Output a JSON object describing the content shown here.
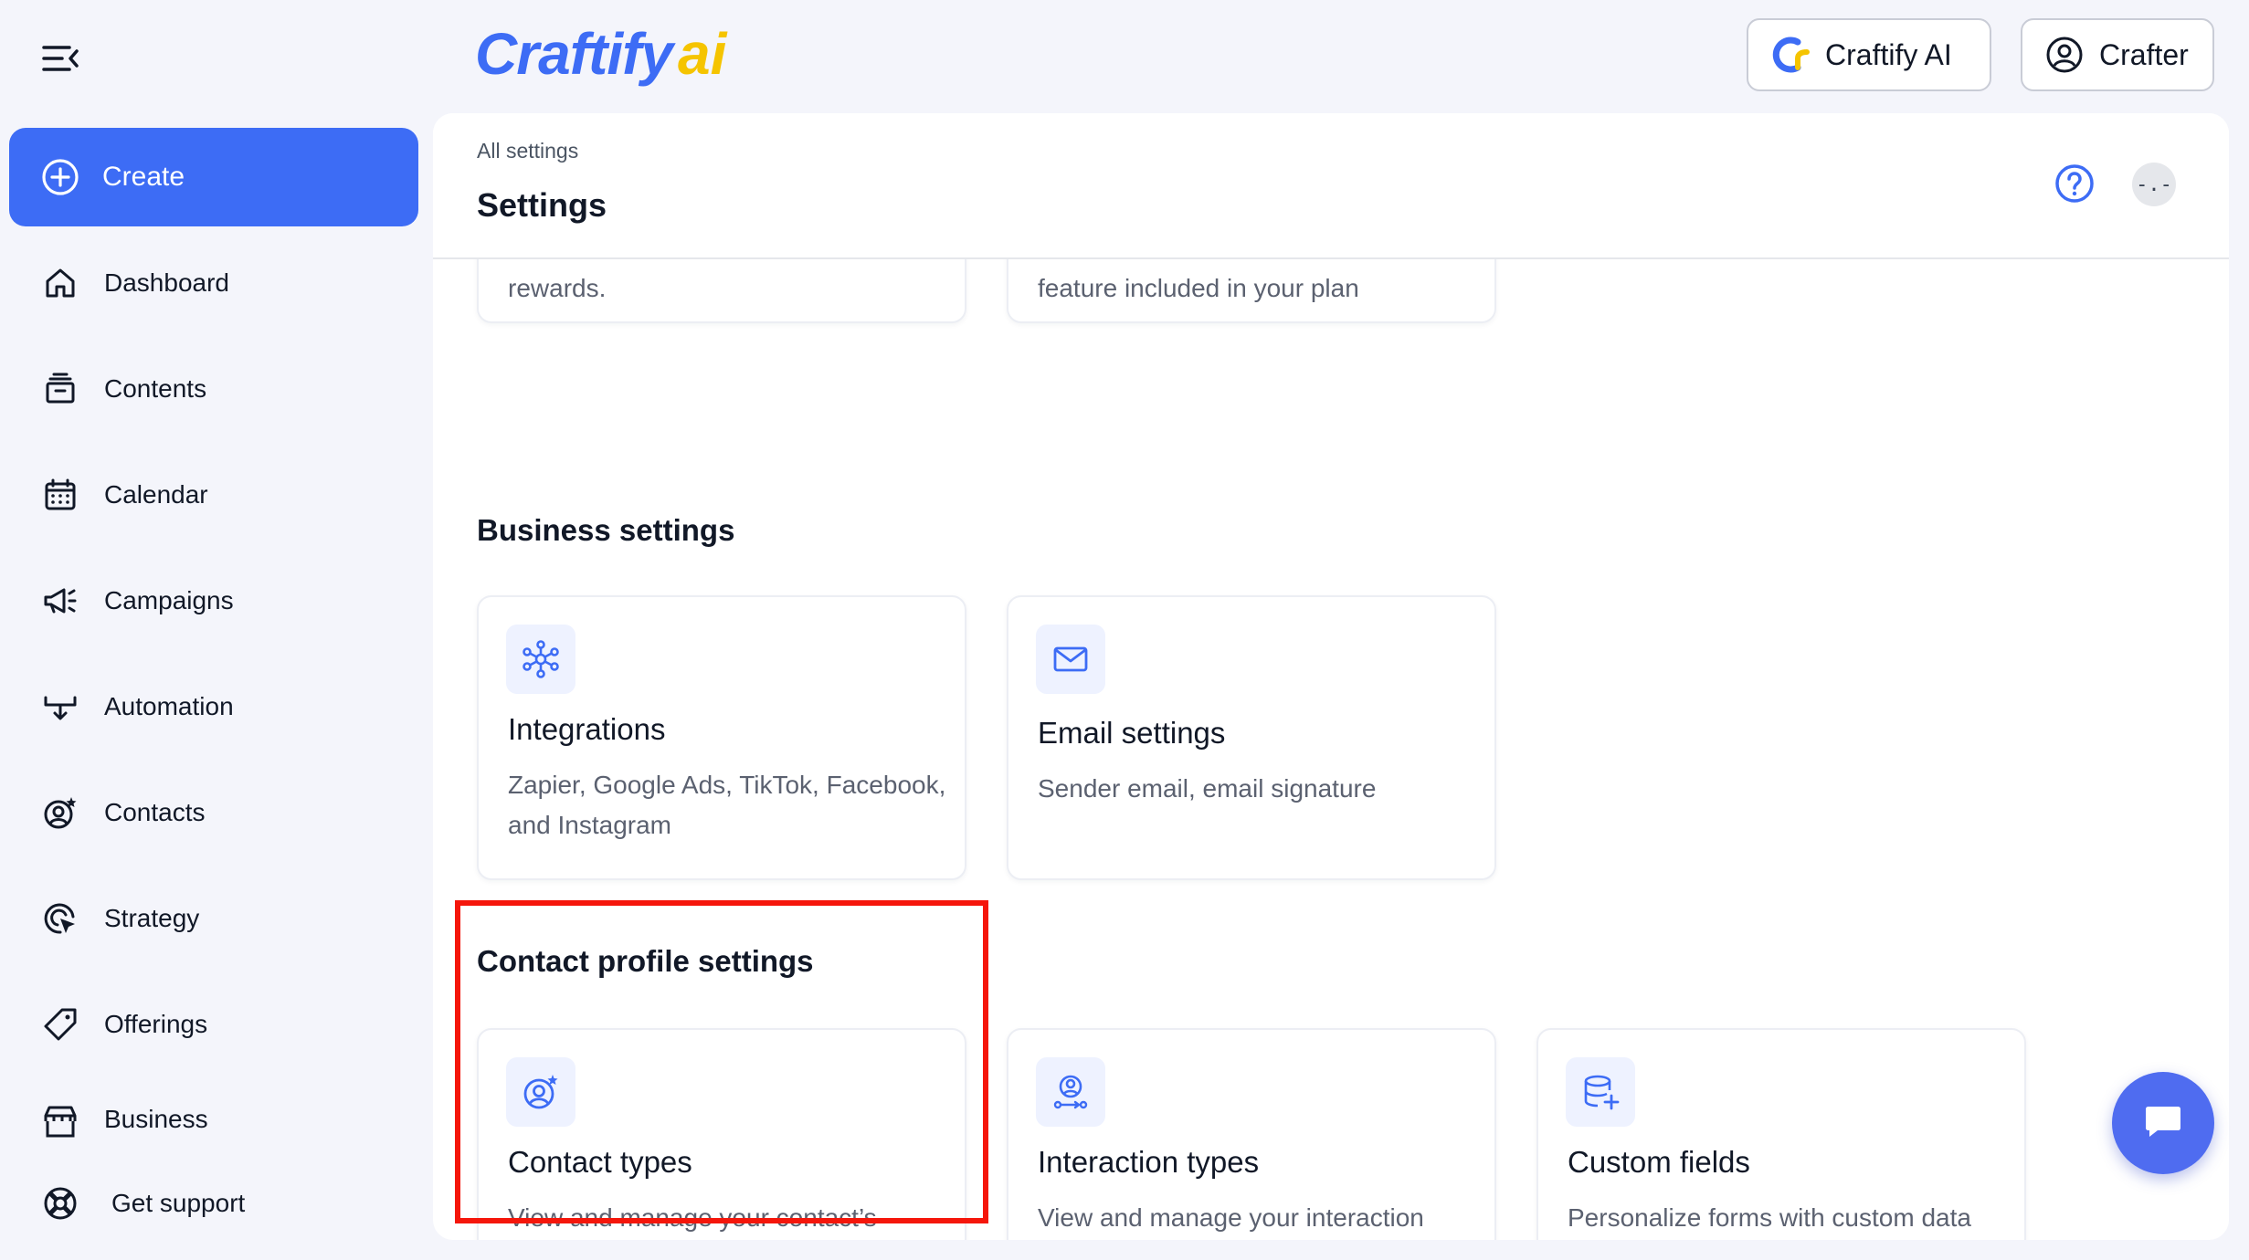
{
  "brand": {
    "logo_word": "Craftify",
    "logo_suffix": "ai",
    "blue": "#3d6cf5",
    "yellow": "#f5c400"
  },
  "topbar": {
    "ai_button_label": "Craftify AI",
    "account_button_label": "Crafter"
  },
  "sidebar": {
    "create_label": "Create",
    "items": [
      {
        "label": "Dashboard",
        "icon": "home-icon"
      },
      {
        "label": "Contents",
        "icon": "archive-icon"
      },
      {
        "label": "Calendar",
        "icon": "calendar-icon"
      },
      {
        "label": "Campaigns",
        "icon": "megaphone-icon"
      },
      {
        "label": "Automation",
        "icon": "workflow-icon"
      },
      {
        "label": "Contacts",
        "icon": "user-star-icon"
      },
      {
        "label": "Strategy",
        "icon": "target-cursor-icon"
      },
      {
        "label": "Offerings",
        "icon": "tag-icon"
      },
      {
        "label": "Business",
        "icon": "store-icon"
      }
    ],
    "support_label": "Get support"
  },
  "header": {
    "breadcrumb": "All settings",
    "title": "Settings",
    "avatar_text": "-.-"
  },
  "partial_cards": [
    {
      "desc": "rewards."
    },
    {
      "desc": "feature included in your plan"
    }
  ],
  "business_section": {
    "title": "Business settings",
    "cards": [
      {
        "title": "Integrations",
        "desc": "Zapier, Google Ads, TikTok, Facebook, and Instagram",
        "icon": "network-icon"
      },
      {
        "title": "Email settings",
        "desc": "Sender email, email signature",
        "icon": "mail-icon"
      }
    ]
  },
  "contact_section": {
    "title": "Contact profile settings",
    "cards": [
      {
        "title": "Contact types",
        "desc": "View and manage your contact’s types.",
        "icon": "user-star-icon"
      },
      {
        "title": "Interaction types",
        "desc": "View and manage your interaction types.",
        "icon": "user-flow-icon"
      },
      {
        "title": "Custom fields",
        "desc": "Personalize forms with custom data fields.",
        "icon": "database-plus-icon"
      }
    ]
  },
  "colors": {
    "accent": "#3d6cf5",
    "highlight": "#f5160b",
    "fab": "#4f6cf0"
  }
}
